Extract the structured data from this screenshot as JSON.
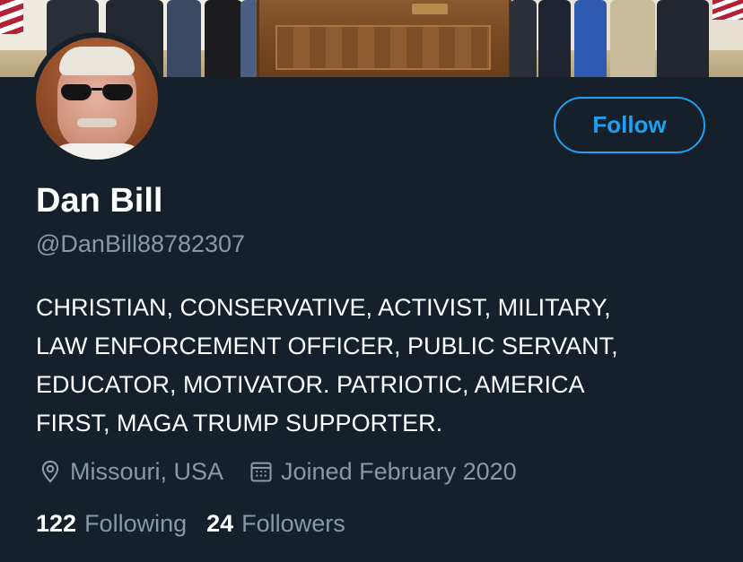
{
  "profile": {
    "name": "Dan Bill",
    "handle": "@DanBill88782307",
    "follow_label": "Follow",
    "bio_lines": [
      "CHRISTIAN, CONSERVATIVE, ACTIVIST, MILITARY,",
      "LAW ENFORCEMENT OFFICER, PUBLIC SERVANT,",
      "EDUCATOR, MOTIVATOR. PATRIOTIC, AMERICA",
      "FIRST, MAGA TRUMP SUPPORTER."
    ],
    "location": "Missouri, USA",
    "location_icon": "location-pin-icon",
    "joined": "Joined February 2020",
    "joined_icon": "calendar-icon",
    "following_count": "122",
    "following_label": "Following",
    "followers_count": "24",
    "followers_label": "Followers"
  },
  "colors": {
    "background": "#15202b",
    "accent": "#1da1f2",
    "secondary_text": "#8899a6",
    "primary_text": "#ffffff"
  }
}
